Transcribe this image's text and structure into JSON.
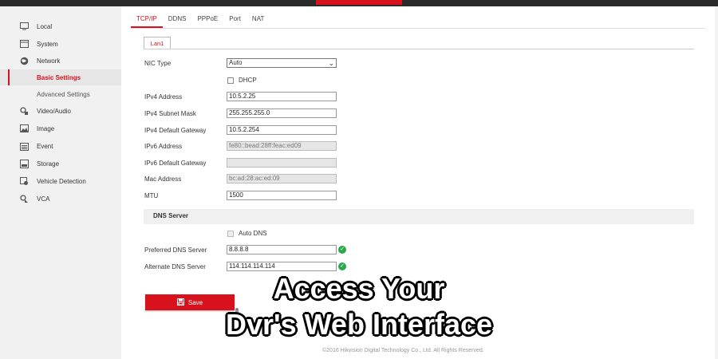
{
  "sidebar": {
    "items": [
      {
        "label": "Local",
        "icon": "monitor-icon"
      },
      {
        "label": "System",
        "icon": "system-icon"
      },
      {
        "label": "Network",
        "icon": "globe-icon"
      },
      {
        "label": "Basic Settings",
        "icon": ""
      },
      {
        "label": "Advanced Settings",
        "icon": ""
      },
      {
        "label": "Video/Audio",
        "icon": "video-audio-icon"
      },
      {
        "label": "Image",
        "icon": "image-icon"
      },
      {
        "label": "Event",
        "icon": "event-icon"
      },
      {
        "label": "Storage",
        "icon": "storage-icon"
      },
      {
        "label": "Vehicle Detection",
        "icon": "vehicle-detection-icon"
      },
      {
        "label": "VCA",
        "icon": "vca-icon"
      }
    ]
  },
  "tabs": [
    "TCP/IP",
    "DDNS",
    "PPPoE",
    "Port",
    "NAT"
  ],
  "subtab": "Lan1",
  "form": {
    "nic_type_label": "NIC Type",
    "nic_type_value": "Auto",
    "dhcp_label": "DHCP",
    "ipv4_address_label": "IPv4 Address",
    "ipv4_address": "10.5.2.25",
    "ipv4_mask_label": "IPv4 Subnet Mask",
    "ipv4_mask": "255.255.255.0",
    "ipv4_gateway_label": "IPv4 Default Gateway",
    "ipv4_gateway": "10.5.2.254",
    "ipv6_address_label": "IPv6 Address",
    "ipv6_address": "fe80::bead:28ff:feac:ed09",
    "ipv6_gateway_label": "IPv6 Default Gateway",
    "ipv6_gateway": "",
    "mac_label": "Mac Address",
    "mac": "bc:ad:28:ac:ed:09",
    "mtu_label": "MTU",
    "mtu": "1500"
  },
  "dns": {
    "header": "DNS Server",
    "auto_label": "Auto DNS",
    "preferred_label": "Preferred DNS Server",
    "preferred": "8.8.8.8",
    "alternate_label": "Alternate DNS Server",
    "alternate": "114.114.114.114"
  },
  "save_label": "Save",
  "footer": "©2016 Hikvision Digital Technology Co., Ltd. All Rights Reserved.",
  "overlay": {
    "line1": "Access Your",
    "line2": "Dvr's Web Interface"
  },
  "colors": {
    "accent": "#d7121d",
    "ok": "#2aa84a"
  }
}
